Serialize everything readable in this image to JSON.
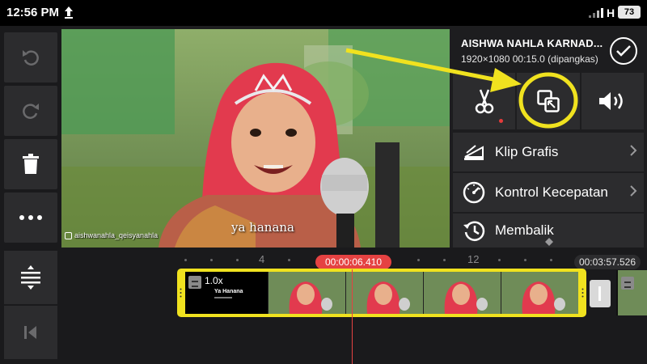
{
  "status_bar": {
    "time": "12:56 PM",
    "network": "H",
    "battery": "73"
  },
  "project": {
    "title": "AISHWA NAHLA KARNAD...",
    "info": "1920×1080  00:15.0 (dipangkas)"
  },
  "preview": {
    "caption": "ya hanana",
    "watermark": "aishwanahla_qeisyanahla"
  },
  "menu": {
    "items": [
      {
        "label": "Klip Grafis",
        "icon": "graphic-clip-icon"
      },
      {
        "label": "Kontrol Kecepatan",
        "icon": "speedometer-icon"
      },
      {
        "label": "Membalik",
        "icon": "history-reverse-icon"
      }
    ]
  },
  "tools": [
    "scissors-icon",
    "pip-layer-icon",
    "volume-icon"
  ],
  "timeline": {
    "current_time": "00:00:06.410",
    "total_time": "00:03:57.526",
    "ruler_labels": [
      "4",
      "12"
    ],
    "title_clip": {
      "speed": "1.0x",
      "title": "Ya Hanana"
    }
  },
  "colors": {
    "accent_yellow": "#f0e21f",
    "playhead_red": "#e54242",
    "panel_bg": "#2c2c2e"
  }
}
